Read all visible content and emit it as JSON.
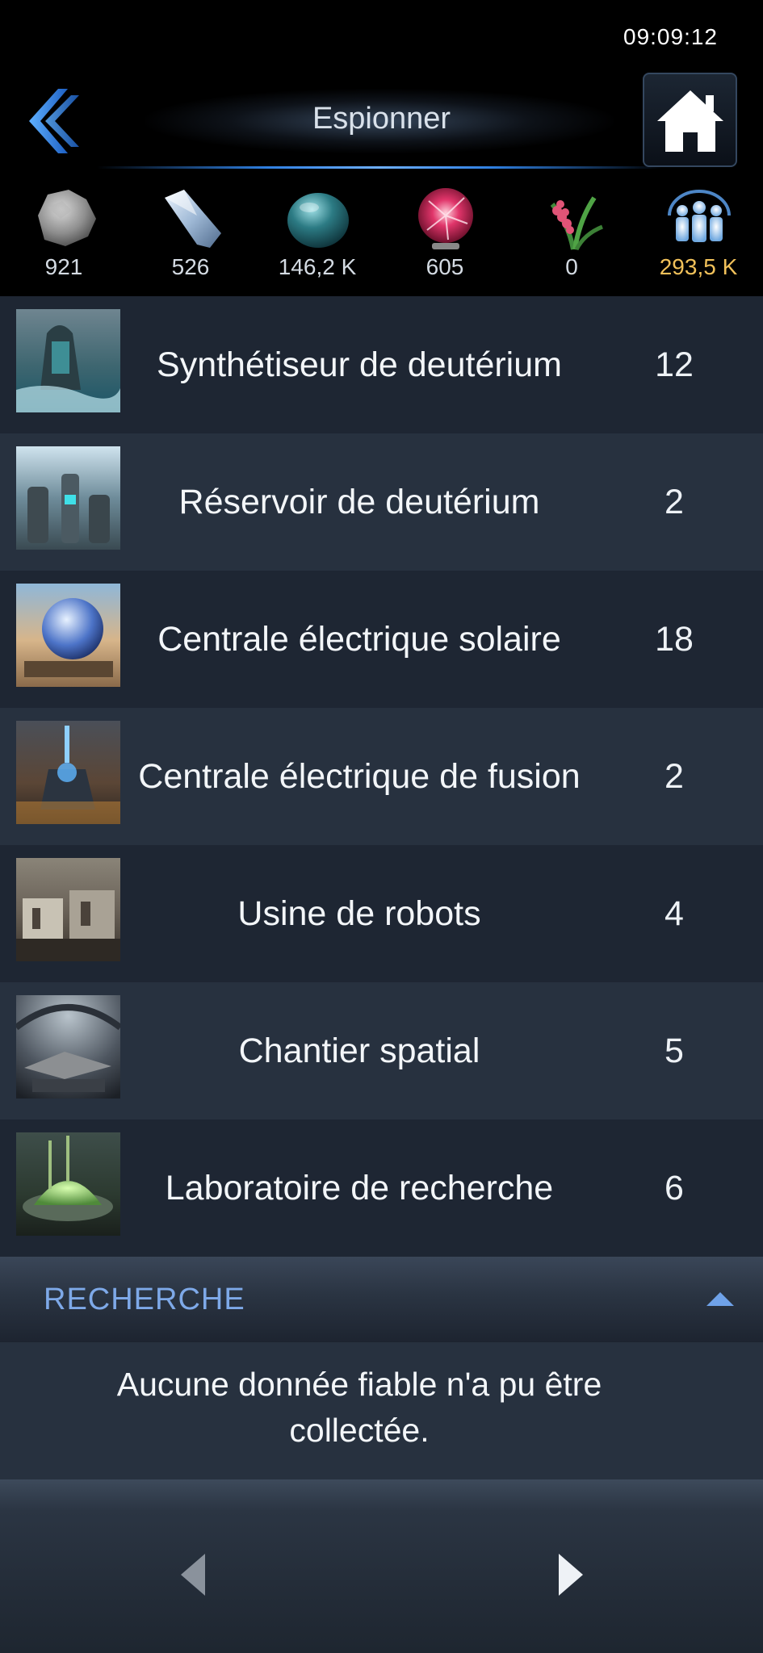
{
  "status_bar": {
    "time": "09:09:12"
  },
  "header": {
    "title": "Espionner",
    "back_icon": "double-chevron-left-icon",
    "home_icon": "home-icon"
  },
  "resources": [
    {
      "icon": "metal-rock-icon",
      "value": "921"
    },
    {
      "icon": "crystal-icon",
      "value": "526"
    },
    {
      "icon": "deuterium-sphere-icon",
      "value": "146,2 K"
    },
    {
      "icon": "energy-plasma-ball-icon",
      "value": "605"
    },
    {
      "icon": "food-plant-icon",
      "value": "0"
    },
    {
      "icon": "population-icon",
      "value": "293,5 K",
      "color": "#f1c15a"
    }
  ],
  "buildings": [
    {
      "name": "Synthétiseur de deutérium",
      "level": "12"
    },
    {
      "name": "Réservoir de deutérium",
      "level": "2"
    },
    {
      "name": "Centrale électrique solaire",
      "level": "18"
    },
    {
      "name": "Centrale électrique de fusion",
      "level": "2"
    },
    {
      "name": "Usine de robots",
      "level": "4"
    },
    {
      "name": "Chantier spatial",
      "level": "5"
    },
    {
      "name": "Laboratoire de recherche",
      "level": "6"
    }
  ],
  "research_section": {
    "title": "RECHERCHE",
    "toggle_icon": "caret-up-icon",
    "message": "Aucune donnée fiable n'a pu être collectée."
  },
  "footer": {
    "prev_icon": "triangle-left-icon",
    "next_icon": "triangle-right-icon"
  },
  "colors": {
    "accent_blue": "#2f7fe0",
    "section_title": "#7ea9e8",
    "population_gold": "#f1c15a",
    "row_dark": "#1e2633",
    "row_light": "#27313f"
  }
}
